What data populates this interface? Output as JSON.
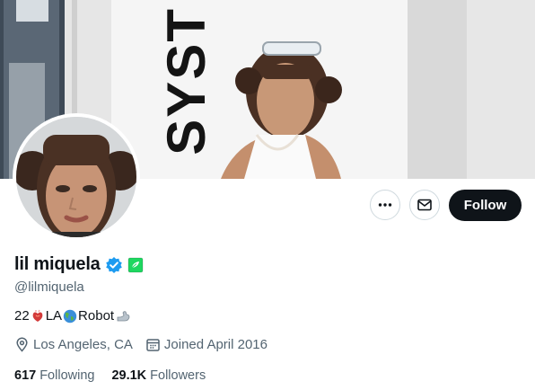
{
  "profile": {
    "display_name": "lil miquela",
    "handle": "@lilmiquela",
    "bio": {
      "part1": "22",
      "part2": "LA",
      "part3": "Robot"
    },
    "location": "Los Angeles, CA",
    "joined": "Joined April 2016",
    "following_count": "617",
    "following_label": "Following",
    "followers_count": "29.1K",
    "followers_label": "Followers"
  },
  "banner": {
    "sign_text": "SYST"
  },
  "actions": {
    "follow_label": "Follow"
  },
  "icons": {
    "more": "more-icon",
    "message": "mail-icon",
    "verified": "verified-badge-icon",
    "affiliate": "affiliate-badge-icon",
    "location": "location-pin-icon",
    "calendar": "calendar-icon",
    "bio_emoji_1": "anatomical-heart-emoji",
    "bio_emoji_2": "globe-americas-emoji",
    "bio_emoji_3": "mechanical-arm-emoji"
  },
  "colors": {
    "verified": "#1d9bf0",
    "affiliate": "#1ed760",
    "follow_button": "#0f1419",
    "secondary_text": "#536471"
  }
}
